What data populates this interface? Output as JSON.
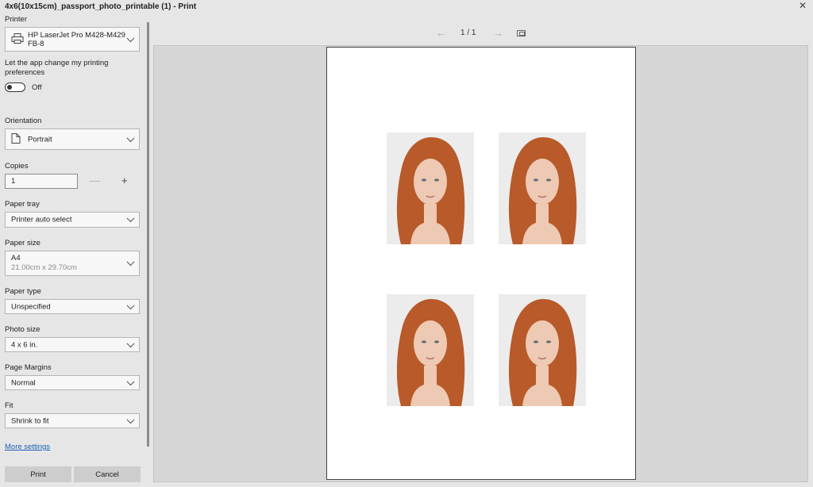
{
  "window": {
    "title": "4x6(10x15cm)_passport_photo_printable (1) - Print",
    "close_glyph": "✕"
  },
  "settings": {
    "printer_label": "Printer",
    "printer_name_line1": "HP LaserJet Pro M428-M429",
    "printer_name_line2": "FB-8",
    "pref_label_line1": "Let the app change my printing",
    "pref_label_line2": "preferences",
    "pref_state": "Off",
    "orientation_label": "Orientation",
    "orientation_value": "Portrait",
    "copies_label": "Copies",
    "copies_value": "1",
    "minus_glyph": "—",
    "plus_glyph": "+",
    "tray_label": "Paper tray",
    "tray_value": "Printer auto select",
    "size_label": "Paper size",
    "size_value": "A4",
    "size_sub": "21.00cm x 29.70cm",
    "type_label": "Paper type",
    "type_value": "Unspecified",
    "photo_label": "Photo size",
    "photo_value": "4 x 6 in.",
    "margins_label": "Page Margins",
    "margins_value": "Normal",
    "fit_label": "Fit",
    "fit_value": "Shrink to fit",
    "more_settings": "More settings"
  },
  "buttons": {
    "print": "Print",
    "cancel": "Cancel"
  },
  "preview": {
    "page_indicator": "1 / 1",
    "prev_glyph": "←",
    "next_glyph": "→",
    "photo_count": 4
  },
  "colors": {
    "hair": "#b85a2a",
    "skin": "#eec9b3",
    "photo_bg": "#ececec",
    "link": "#1a5fb4"
  }
}
